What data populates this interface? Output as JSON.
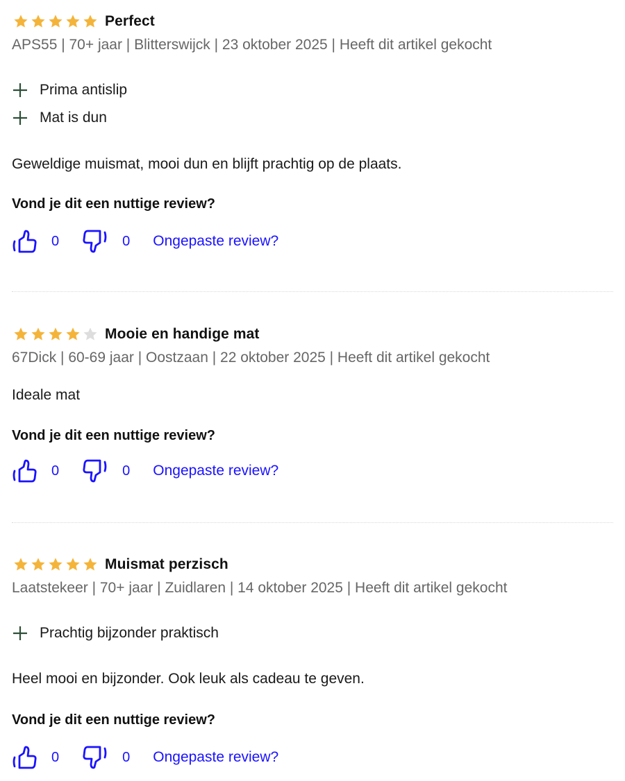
{
  "colors": {
    "star_filled": "#f4b43a",
    "star_empty": "#dddddd",
    "link": "#1a12ff",
    "pro_icon": "#2d4f38"
  },
  "reviews": [
    {
      "rating": 5,
      "title": "Perfect",
      "meta": "APS55 | 70+ jaar | Blitterswijck | 23 oktober 2025 | Heeft dit artikel gekocht",
      "pros": [
        "Prima antislip",
        "Mat is dun"
      ],
      "text": "Geweldige muismat, mooi dun en blijft prachtig op de plaats.",
      "helpful_question": "Vond je dit een nuttige review?",
      "likes": "0",
      "dislikes": "0",
      "report_label": "Ongepaste review?"
    },
    {
      "rating": 4,
      "title": "Mooie en handige mat",
      "meta": "67Dick | 60-69 jaar | Oostzaan | 22 oktober 2025 | Heeft dit artikel gekocht",
      "pros": [],
      "text": "Ideale mat",
      "helpful_question": "Vond je dit een nuttige review?",
      "likes": "0",
      "dislikes": "0",
      "report_label": "Ongepaste review?"
    },
    {
      "rating": 5,
      "title": "Muismat perzisch",
      "meta": "Laatstekeer | 70+ jaar | Zuidlaren | 14 oktober 2025 | Heeft dit artikel gekocht",
      "pros": [
        "Prachtig bijzonder praktisch"
      ],
      "text": "Heel mooi en bijzonder. Ook leuk als cadeau te geven.",
      "helpful_question": "Vond je dit een nuttige review?",
      "likes": "0",
      "dislikes": "0",
      "report_label": "Ongepaste review?"
    }
  ]
}
